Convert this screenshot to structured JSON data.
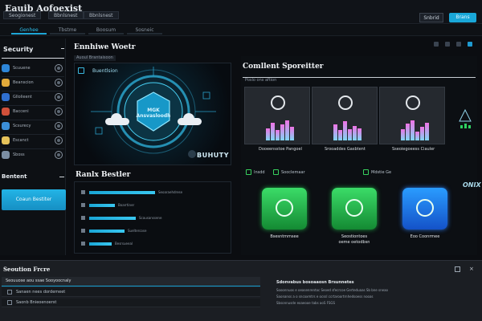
{
  "app": {
    "title": "Eauib Aofoexist",
    "tabs": [
      "Seogionest",
      "Bbnlsnest"
    ],
    "btn_dark": "Snbrid",
    "btn_cyan": "Brans"
  },
  "subnav": [
    "Genhee",
    "Tbstme",
    "Boosum",
    "Sosneic"
  ],
  "sidebar": {
    "title": "Security",
    "items": [
      {
        "label": "Scuuene",
        "color": "#2d86d8"
      },
      {
        "label": "Beanscion",
        "color": "#e0a93a"
      },
      {
        "label": "Gllolieent",
        "color": "#2f6fd0"
      },
      {
        "label": "Bacceni",
        "color": "#d0503a"
      },
      {
        "label": "Scsurecy",
        "color": "#3b8ed8"
      },
      {
        "label": "Escanct",
        "color": "#e5c25a"
      },
      {
        "label": "Sboss",
        "color": "#7b8ea3"
      }
    ],
    "section": "Bentent",
    "cta": "Coaun Bestiter"
  },
  "hero": {
    "title": "Ennhiwe Woetr",
    "subtitle": "Auoul Brantaisoon",
    "label": "Buentlsion",
    "shield_line1": "MGK",
    "shield_line2": "Ansvasloodh",
    "brand": "BUHUTY"
  },
  "bars": {
    "title": "Ranlx Bestler",
    "rows": [
      {
        "value": 0.82,
        "label": "Seoaraehdrese"
      },
      {
        "value": 0.32,
        "label": "Boarrtiner"
      },
      {
        "value": 0.58,
        "label": "Scausanssene"
      },
      {
        "value": 0.44,
        "label": "Sueltercose"
      },
      {
        "value": 0.28,
        "label": "Besrsueeal"
      }
    ]
  },
  "right": {
    "title": "Comllent Sporeitter",
    "subtitle": "Poslo ons aftion",
    "charts": [
      {
        "caption": "Dooeensstoe Pangoel",
        "bars": [
          0.55,
          0.8,
          0.45,
          0.7,
          0.9,
          0.6
        ]
      },
      {
        "caption": "Srooaddes Gasbtent",
        "bars": [
          0.7,
          0.45,
          0.85,
          0.5,
          0.65,
          0.55
        ]
      },
      {
        "caption": "Sseoiegoeess Ciauler",
        "bars": [
          0.5,
          0.75,
          0.9,
          0.4,
          0.6,
          0.8
        ]
      }
    ],
    "mini_labels": [
      "Insdd",
      "Sooclemaar",
      "Mdstie Ge"
    ],
    "tiles": [
      {
        "caption1": "Bsesntmmsee",
        "caption2": "",
        "style": "green"
      },
      {
        "caption1": "Seostiontoes",
        "caption2": "oeme oetodbsn",
        "style": "green"
      },
      {
        "caption1": "Eoo Coonrmee",
        "caption2": "",
        "style": "blue"
      }
    ],
    "nix": "ONIX"
  },
  "bottom": {
    "title": "Seoution Frcre",
    "head": "Seouuose aou ssae Sooyoocnaly",
    "rows": [
      "Sanaen nees dordemeet",
      "Saonb Bnieoenoerst"
    ],
    "detail_head": "Sdonvabus bosoaaosn Brsunnetes",
    "detail_lines": [
      "Sooonnuos e oeasenrentoc Seoed sfecrcoe Gerteduaas Sb bne sneao",
      "Saonanss a o sncoxmtrs e ocssl ccrtaroortrnhedsoess nooas",
      "Sbsonnusde eoaeooe tabs aoS FSGS"
    ]
  }
}
